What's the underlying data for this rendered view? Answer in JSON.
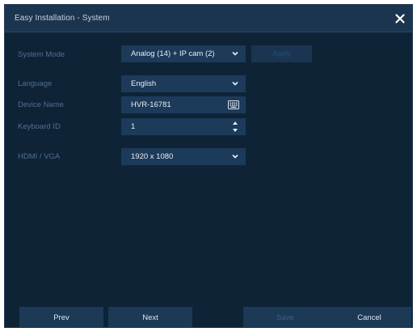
{
  "window": {
    "title": "Easy Installation - System"
  },
  "form": {
    "system_mode": {
      "label": "System Mode",
      "value": "Analog (14) + IP cam (2)"
    },
    "apply_label": "Apply",
    "language": {
      "label": "Language",
      "value": "English"
    },
    "device_name": {
      "label": "Device Name",
      "value": "HVR-16781"
    },
    "keyboard_id": {
      "label": "Keyboard ID",
      "value": "1"
    },
    "hdmi_vga": {
      "label": "HDMI / VGA",
      "value": "1920 x 1080"
    }
  },
  "footer": {
    "prev_label": "Prev",
    "next_label": "Next",
    "save_label": "Save",
    "cancel_label": "Cancel"
  },
  "icons": {
    "close": "close-icon",
    "dropdown": "chevron-down-icon",
    "keyboard": "keyboard-icon",
    "stepper": "up-down-stepper-icon"
  },
  "colors": {
    "background": "#0f2337",
    "titlebar": "#1b3550",
    "control": "#1c3a59",
    "label_text": "#4f6f91",
    "value_text": "#e8eef5",
    "disabled_text": "#3c5f84"
  }
}
